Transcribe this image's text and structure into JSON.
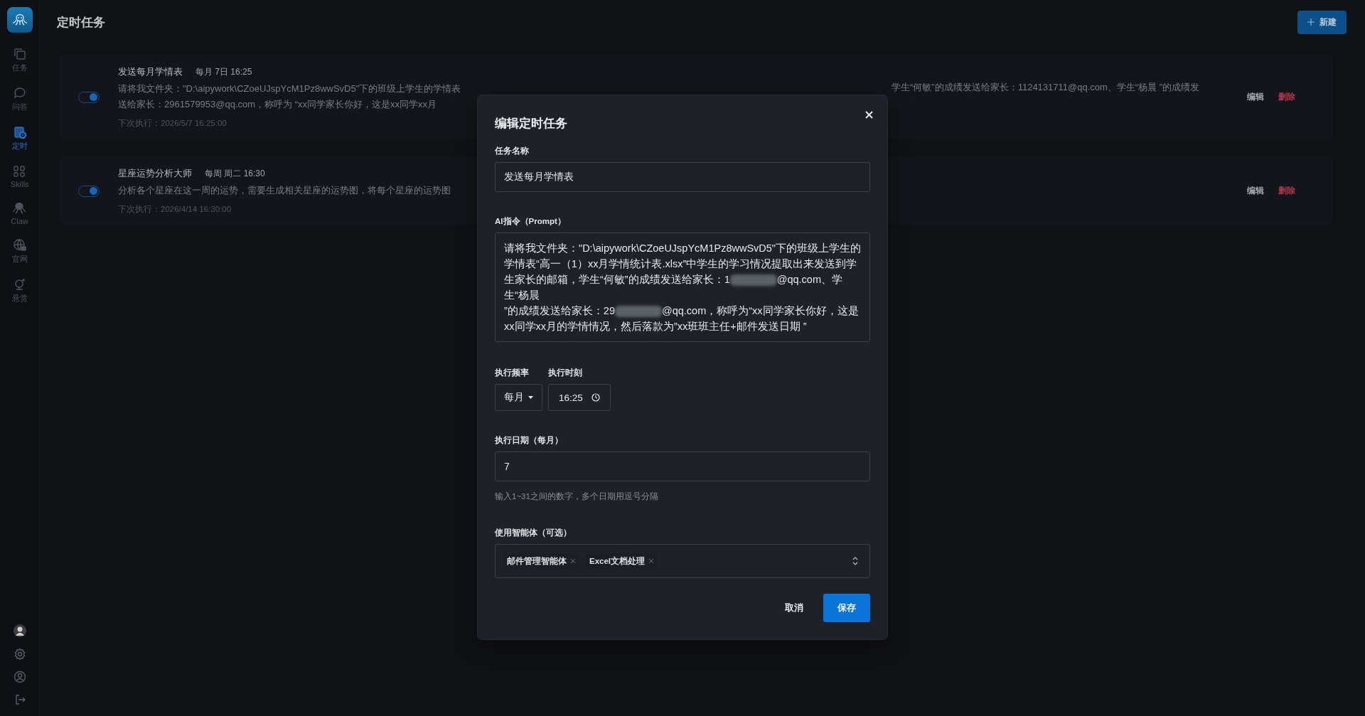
{
  "sidebar": {
    "items": [
      {
        "label": "任务",
        "selected": false
      },
      {
        "label": "问答",
        "selected": false
      },
      {
        "label": "定时",
        "selected": true
      },
      {
        "label": "Skills",
        "selected": false
      },
      {
        "label": "Claw",
        "selected": false
      },
      {
        "label": "官网",
        "selected": false
      },
      {
        "label": "悬赏",
        "selected": false
      }
    ]
  },
  "header": {
    "title": "定时任务",
    "new_button": "新建"
  },
  "tasks": [
    {
      "enabled": true,
      "name": "发送每月学情表",
      "schedule": "每月 7日 16:25",
      "lines": [
        {
          "start": "请将我文件夹：\"D:\\aipywork\\CZoeUJspYcM1Pz8wwSvD5\"下的班级上学生的学情表",
          "end": "学生“何敏”的成绩发送给家长：1124131711@qq.com、学生“杨晨 ”的成绩发"
        },
        {
          "start": "送给家长：2961579953@qq.com，称呼为 “xx同学家长你好，这是xx同学xx月"
        }
      ],
      "next_run": "下次执行：2026/5/7 16:25:00",
      "edit": "编辑",
      "delete": "删除"
    },
    {
      "enabled": true,
      "name": "星座运势分析大师",
      "schedule": "每周 周二 16:30",
      "lines": [
        {
          "start": "分析各个星座在这一周的运势，需要生成相关星座的运势图，将每个星座的运势图"
        }
      ],
      "next_run": "下次执行：2026/4/14 16:30:00",
      "edit": "编辑",
      "delete": "删除"
    }
  ],
  "modal": {
    "title": "编辑定时任务",
    "name_label": "任务名称",
    "name_value": "发送每月学情表",
    "prompt_label": "AI指令（Prompt）",
    "prompt_parts": [
      {
        "kind": "text",
        "text": "请将我文件夹：\"D:\\aipywork\\CZoeUJspYcM1Pz8wwSvD5\"下的班级上学生的学情表“高一（1）xx月学情统计表.xlsx”中学生的学习情况提取出来发送到学生家长的邮箱，学生“何敏”的成绩发送给家长：1"
      },
      {
        "kind": "redacted"
      },
      {
        "kind": "text",
        "text": "@qq.com、学生“杨晨\n”的成绩发送给家长：29"
      },
      {
        "kind": "redacted"
      },
      {
        "kind": "text",
        "text": "@qq.com，称呼为“xx同学家长你好，这是xx同学xx月的学情情况，然后落款为”xx班班主任+邮件发送日期 ”"
      }
    ],
    "frequency_label": "执行频率",
    "frequency_value": "每月",
    "time_label": "执行时刻",
    "time_value": "16:25",
    "date_label": "执行日期（每月）",
    "date_value": "7",
    "date_hint": "输入1~31之间的数字，多个日期用逗号分隔",
    "agents_label": "使用智能体（可选）",
    "agents": [
      "邮件管理智能体",
      "Excel文档处理"
    ],
    "cancel": "取消",
    "save": "保存"
  }
}
